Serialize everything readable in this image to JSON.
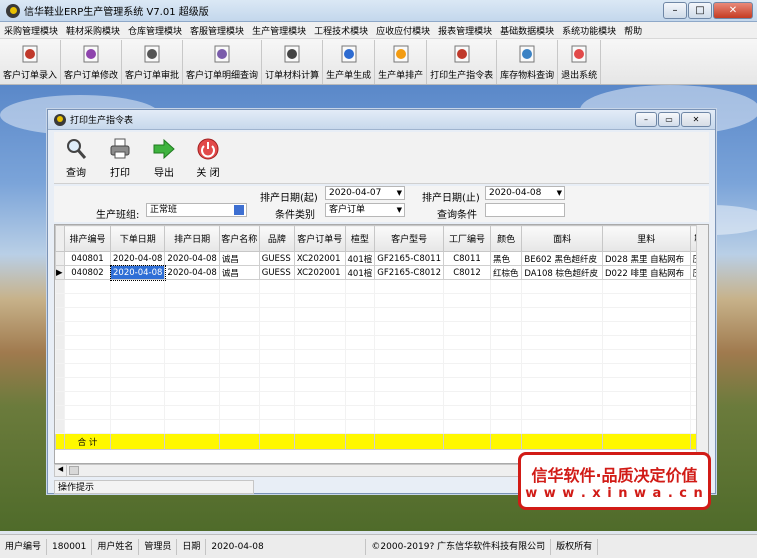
{
  "app": {
    "title": "信华鞋业ERP生产管理系统   V7.01   超级版"
  },
  "menu": [
    "采购管理模块",
    "鞋材采购模块",
    "仓库管理模块",
    "客服管理模块",
    "生产管理模块",
    "工程技术模块",
    "应收应付模块",
    "报表管理模块",
    "基础数据模块",
    "系统功能模块",
    "帮助"
  ],
  "toolbar": [
    {
      "label": "客户订单录入",
      "icon": "pdf-doc-icon"
    },
    {
      "label": "客户订单修改",
      "icon": "edit-doc-icon"
    },
    {
      "label": "客户订单审批",
      "icon": "approve-doc-icon"
    },
    {
      "label": "客户订单明细查询",
      "icon": "query-doc-icon"
    },
    {
      "label": "订单材料计算",
      "icon": "calculator-icon"
    },
    {
      "label": "生产单生成",
      "icon": "generate-doc-icon"
    },
    {
      "label": "生产单排产",
      "icon": "schedule-icon"
    },
    {
      "label": "打印生产指令表",
      "icon": "print-doc-icon"
    },
    {
      "label": "库存物料查询",
      "icon": "inventory-icon"
    },
    {
      "label": "退出系统",
      "icon": "power-icon"
    }
  ],
  "child": {
    "title": "打印生产指令表",
    "tools": [
      {
        "label": "查询"
      },
      {
        "label": "打印"
      },
      {
        "label": "导出"
      },
      {
        "label": "关 闭"
      }
    ],
    "filters": {
      "start_label": "排产日期(起)",
      "start_value": "2020-04-07",
      "end_label": "排产日期(止)",
      "end_value": "2020-04-08",
      "team_label": "生产班组:",
      "team_value": "正常班",
      "type_label": "条件类别",
      "type_value": "客户订单",
      "cond_label": "查询条件",
      "cond_value": ""
    },
    "columns": [
      "排产编号",
      "下单日期",
      "排产日期",
      "客户名称",
      "品牌",
      "客户订单号",
      "楦型",
      "客户型号",
      "工厂编号",
      "颜色",
      "面料",
      "里料",
      "鞋"
    ],
    "rows": [
      [
        "040801",
        "2020-04-08",
        "2020-04-08",
        "诚昌",
        "GUESS",
        "XC202001",
        "401楦",
        "GF2165-C8011",
        "C8011",
        "黑色",
        "BE602 黑色超纤皮",
        "D028 黑里 自粘网布",
        "压"
      ],
      [
        "040802",
        "2020-04-08",
        "2020-04-08",
        "诚昌",
        "GUESS",
        "XC202001",
        "401楦",
        "GF2165-C8012",
        "C8012",
        "红棕色",
        "DA108 棕色超纤皮",
        "D022 啡里 自粘网布",
        "压"
      ]
    ],
    "total_label": "合 计",
    "status_hint": "操作提示"
  },
  "watermark": {
    "line1": "信华软件·品质决定价值",
    "line2": "w w w . x i n w a . c n"
  },
  "statusbar": {
    "user_id_label": "用户编号",
    "user_id": "180001",
    "user_name_label": "用户姓名",
    "user_name": "管理员",
    "date_label": "日期",
    "date": "2020-04-08",
    "copyright": "©2000-2019?  广东信华软件科技有限公司",
    "rights": "版权所有"
  }
}
